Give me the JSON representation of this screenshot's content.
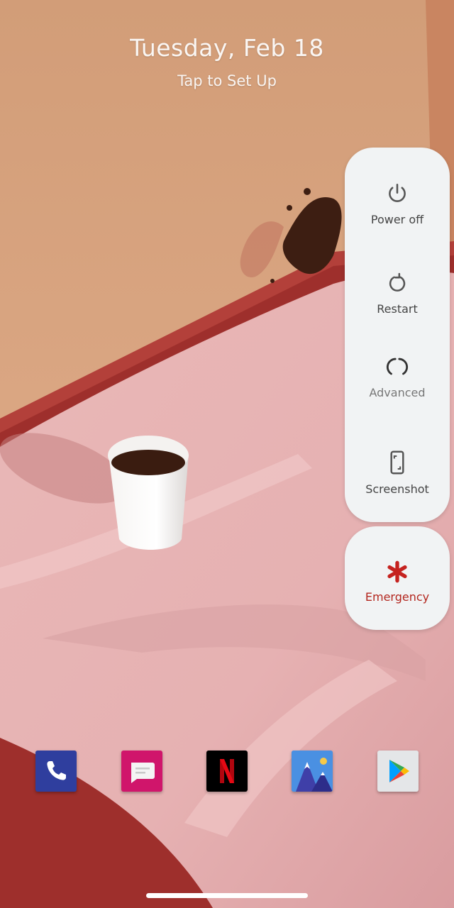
{
  "lockscreen": {
    "date": "Tuesday, Feb 18",
    "setup_hint": "Tap to Set Up"
  },
  "power_menu": {
    "power_off_label": "Power off",
    "restart_label": "Restart",
    "advanced_label": "Advanced",
    "screenshot_label": "Screenshot",
    "emergency_label": "Emergency"
  },
  "dock": {
    "apps": [
      "phone-icon",
      "messages-icon",
      "netflix-icon",
      "gallery-icon",
      "play-store-icon"
    ]
  },
  "colors": {
    "menu_bg": "#f1f3f4",
    "emergency_red": "#c5221f",
    "wall": "#d9a37e",
    "cloth": "#e8b6b6",
    "table_red": "#b23a36"
  }
}
